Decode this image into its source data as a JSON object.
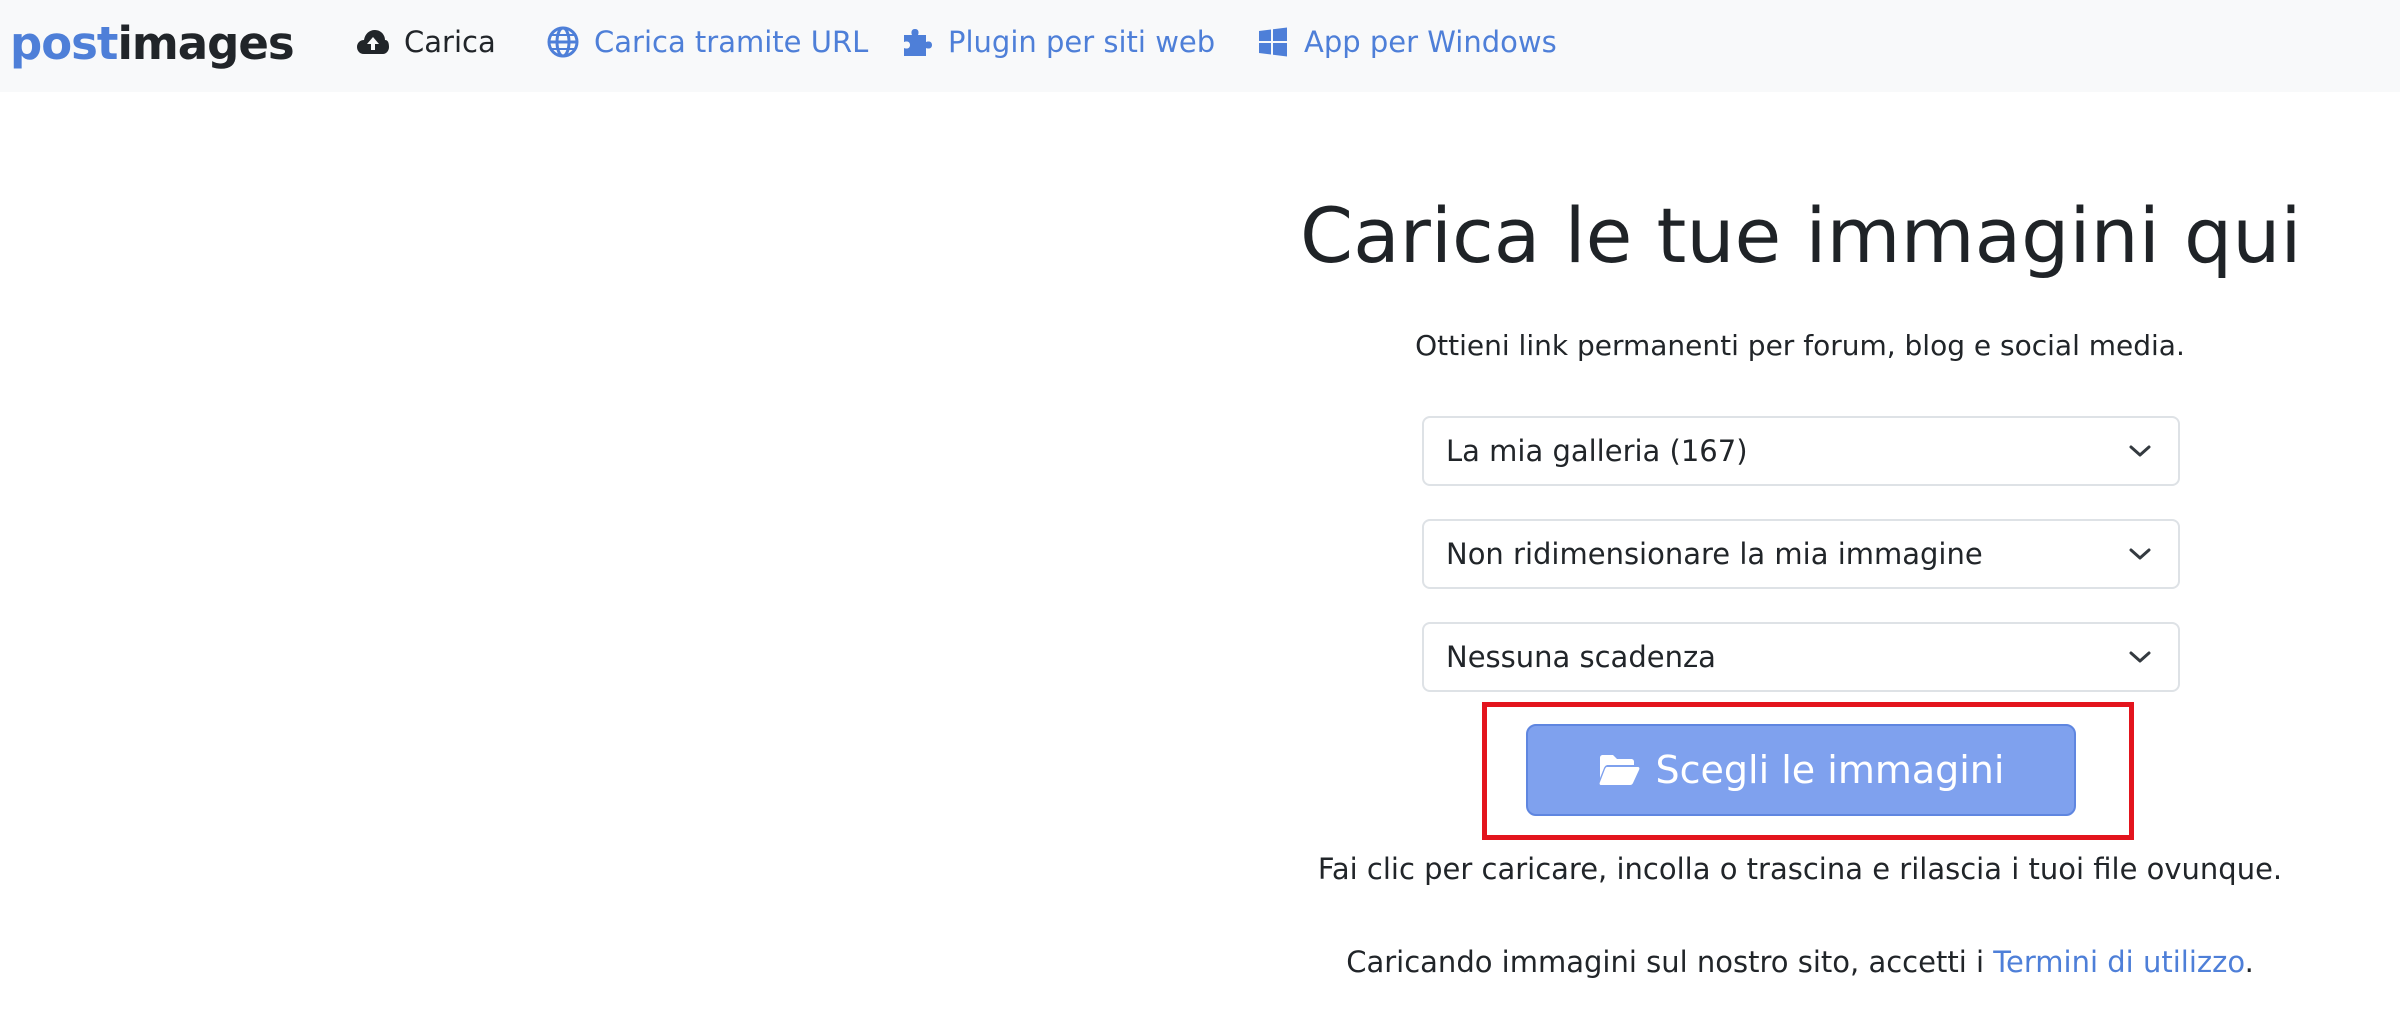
{
  "brand": {
    "logo_part1": "post",
    "logo_part2": "images"
  },
  "nav": {
    "items": [
      {
        "label": "Carica",
        "icon": "cloud-upload-icon"
      },
      {
        "label": "Carica tramite URL",
        "icon": "globe-icon"
      },
      {
        "label": "Plugin per siti web",
        "icon": "puzzle-icon"
      },
      {
        "label": "App per Windows",
        "icon": "windows-icon"
      }
    ]
  },
  "hero": {
    "title": "Carica le tue immagini qui",
    "subtitle": "Ottieni link permanenti per forum, blog e social media."
  },
  "options": {
    "gallery": "La mia galleria (167)",
    "resize": "Non ridimensionare la mia immagine",
    "expiry": "Nessuna scadenza"
  },
  "upload": {
    "button_label": "Scegli le immagini",
    "button_icon": "folder-open-icon",
    "help": "Fai clic per caricare, incolla o trascina e rilascia i tuoi file ovunque."
  },
  "terms": {
    "prefix": "Caricando immagini sul nostro sito, accetti i ",
    "link": "Termini di utilizzo",
    "suffix": "."
  },
  "colors": {
    "brand_blue": "#4e7fd8",
    "button_bg": "#7fa1ee",
    "highlight_red": "#e3141d",
    "navbar_bg": "#f8f9fa"
  }
}
